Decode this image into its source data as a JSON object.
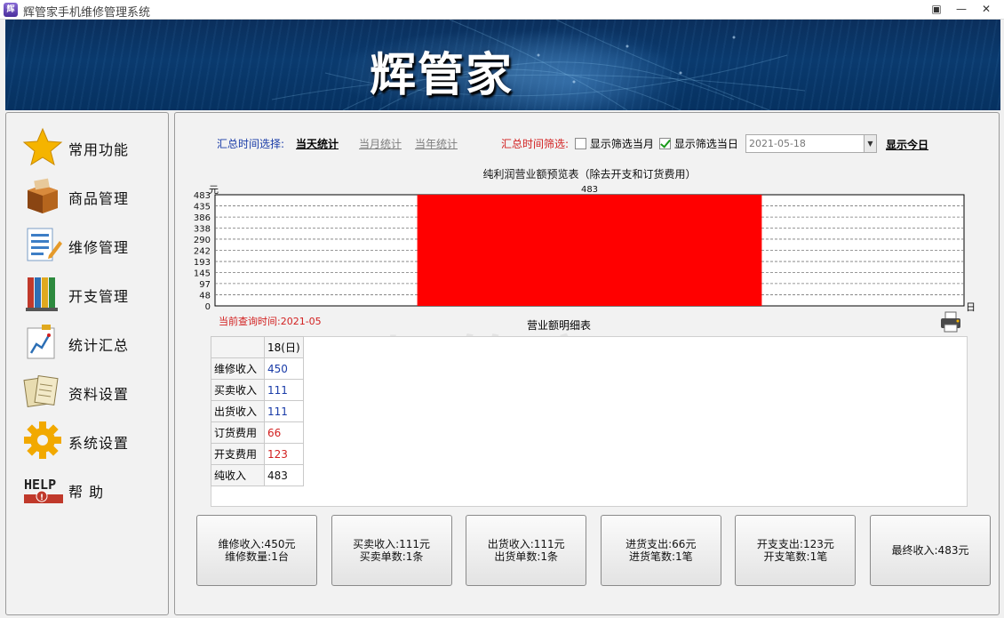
{
  "window": {
    "title": "辉管家手机维修管理系统",
    "app_icon": "辉",
    "controls": [
      "restore-icon",
      "minimize-icon",
      "close-icon"
    ],
    "control_glyphs": {
      "restore": "▣",
      "minimize": "—",
      "close": "✕"
    }
  },
  "banner": {
    "brand": "辉管家"
  },
  "sidebar": {
    "items": [
      {
        "label": "常用功能",
        "icon": "star-icon"
      },
      {
        "label": "商品管理",
        "icon": "box-icon"
      },
      {
        "label": "维修管理",
        "icon": "edit-list-icon"
      },
      {
        "label": "开支管理",
        "icon": "books-icon"
      },
      {
        "label": "统计汇总",
        "icon": "chart-icon"
      },
      {
        "label": "资料设置",
        "icon": "documents-icon"
      },
      {
        "label": "系统设置",
        "icon": "gear-icon"
      },
      {
        "label": "帮 助",
        "icon": "help-icon"
      }
    ]
  },
  "filters": {
    "period_label": "汇总时间选择:",
    "period_today": "当天统计",
    "period_month": "当月统计",
    "period_year": "当年统计",
    "filter_label": "汇总时间筛选:",
    "show_month_label": "显示筛选当月",
    "show_month_checked": false,
    "show_day_label": "显示筛选当日",
    "show_day_checked": true,
    "date_value": "2021-05-18",
    "show_today_label": "显示今日"
  },
  "chart_data": {
    "type": "bar",
    "title": "纯利润营业额预览表（除去开支和订货费用）",
    "ylabel": "元",
    "xlabel": "日",
    "y_ticks": [
      0,
      48,
      97,
      145,
      193,
      242,
      290,
      338,
      386,
      435,
      483
    ],
    "ylim": [
      0,
      483
    ],
    "grid": true,
    "bar_color": "#ff0000",
    "categories": [
      "18"
    ],
    "values": [
      483
    ],
    "data_labels": [
      "483"
    ]
  },
  "detail": {
    "query_time": "当前查询时间:2021-05",
    "title": "营业额明细表",
    "print_icon": "printer-icon",
    "column_header": "18(日)",
    "rows": [
      {
        "label": "维修收入",
        "value": "450",
        "color": "#1a3ca8"
      },
      {
        "label": "买卖收入",
        "value": "111",
        "color": "#1a3ca8"
      },
      {
        "label": "出货收入",
        "value": "111",
        "color": "#1a3ca8"
      },
      {
        "label": "订货费用",
        "value": "66",
        "color": "#d21f1f"
      },
      {
        "label": "开支费用",
        "value": "123",
        "color": "#d21f1f"
      },
      {
        "label": "纯收入",
        "value": "483",
        "color": "#111111"
      }
    ]
  },
  "summary_buttons": [
    {
      "line1": "维修收入:450元",
      "line2": "维修数量:1台"
    },
    {
      "line1": "买卖收入:111元",
      "line2": "买卖单数:1条"
    },
    {
      "line1": "出货收入:111元",
      "line2": "出货单数:1条"
    },
    {
      "line1": "进货支出:66元",
      "line2": "进货笔数:1笔"
    },
    {
      "line1": "开支支出:123元",
      "line2": "开支笔数:1笔"
    },
    {
      "line1": "最终收入:483元",
      "line2": ""
    }
  ],
  "watermark": "辉管家"
}
